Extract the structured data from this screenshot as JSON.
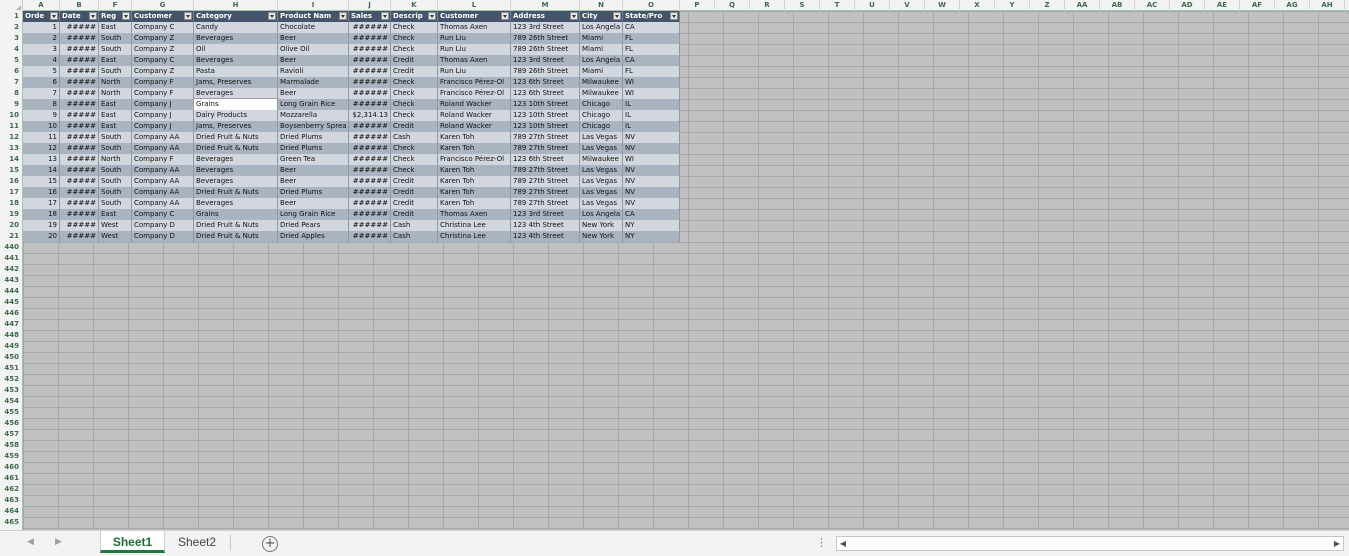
{
  "sheet": {
    "columns": [
      "A",
      "B",
      "F",
      "G",
      "H",
      "I",
      "J",
      "K",
      "L",
      "M",
      "N",
      "O",
      "P",
      "Q",
      "R",
      "S",
      "T",
      "U",
      "V",
      "W",
      "X",
      "Y",
      "Z",
      "AA",
      "AB",
      "AC",
      "AD",
      "AE",
      "AF",
      "AG",
      "AH"
    ],
    "row_numbers": [
      "1",
      "2",
      "3",
      "4",
      "5",
      "6",
      "7",
      "8",
      "9",
      "10",
      "11",
      "12",
      "13",
      "14",
      "15",
      "16",
      "17",
      "18",
      "19",
      "20",
      "21",
      "440",
      "441",
      "442",
      "443",
      "444",
      "445",
      "446",
      "447",
      "448",
      "449",
      "450",
      "451",
      "452",
      "453",
      "454",
      "455",
      "456",
      "457",
      "458",
      "459",
      "460",
      "461",
      "462",
      "463",
      "464",
      "465"
    ],
    "table_headers": [
      "Orde",
      "Date",
      "Reg",
      "Customer",
      "Category",
      "Product Nam",
      "Sales",
      "Descrip",
      "Customer",
      "Address",
      "City",
      "State/Pro"
    ],
    "rows": [
      [
        "1",
        "#####",
        "East",
        "Company C",
        "Candy",
        "Chocolate",
        "######",
        "Check",
        "Thomas Axen",
        "123 3rd Street",
        "Los Angela",
        "CA"
      ],
      [
        "2",
        "#####",
        "South",
        "Company Z",
        "Beverages",
        "Beer",
        "######",
        "Check",
        "Run Liu",
        "789 26th Street",
        "Miami",
        "FL"
      ],
      [
        "3",
        "#####",
        "South",
        "Company Z",
        "Oil",
        "Olive Oil",
        "######",
        "Check",
        "Run Liu",
        "789 26th Street",
        "Miami",
        "FL"
      ],
      [
        "4",
        "#####",
        "East",
        "Company C",
        "Beverages",
        "Beer",
        "######",
        "Credit",
        "Thomas Axen",
        "123 3rd Street",
        "Los Angela",
        "CA"
      ],
      [
        "5",
        "#####",
        "South",
        "Company Z",
        "Pasta",
        "Ravioli",
        "######",
        "Credit",
        "Run Liu",
        "789 26th Street",
        "Miami",
        "FL"
      ],
      [
        "6",
        "#####",
        "North",
        "Company F",
        "Jams, Preserves",
        "Marmalade",
        "######",
        "Check",
        "Francisco Pérez-Ol",
        "123 6th Street",
        "Milwaukee",
        "WI"
      ],
      [
        "7",
        "#####",
        "North",
        "Company F",
        "Beverages",
        "Beer",
        "######",
        "Check",
        "Francisco Pérez-Ol",
        "123 6th Street",
        "Milwaukee",
        "WI"
      ],
      [
        "8",
        "#####",
        "East",
        "Company J",
        "Grains",
        "Long Grain Rice",
        "######",
        "Check",
        "Roland Wacker",
        "123 10th Street",
        "Chicago",
        "IL"
      ],
      [
        "9",
        "#####",
        "East",
        "Company J",
        "Dairy Products",
        "Mozzarella",
        "$2,314.13",
        "Check",
        "Roland Wacker",
        "123 10th Street",
        "Chicago",
        "IL"
      ],
      [
        "10",
        "#####",
        "East",
        "Company J",
        "Jams, Preserves",
        "Boysenberry Sprea",
        "######",
        "Credit",
        "Roland Wacker",
        "123 10th Street",
        "Chicago",
        "IL"
      ],
      [
        "11",
        "#####",
        "South",
        "Company AA",
        "Dried Fruit & Nuts",
        "Dried Plums",
        "######",
        "Cash",
        "Karen Toh",
        "789 27th Street",
        "Las Vegas",
        "NV"
      ],
      [
        "12",
        "#####",
        "South",
        "Company AA",
        "Dried Fruit & Nuts",
        "Dried Plums",
        "######",
        "Check",
        "Karen Toh",
        "789 27th Street",
        "Las Vegas",
        "NV"
      ],
      [
        "13",
        "#####",
        "North",
        "Company F",
        "Beverages",
        "Green Tea",
        "######",
        "Check",
        "Francisco Pérez-Ol",
        "123 6th Street",
        "Milwaukee",
        "WI"
      ],
      [
        "14",
        "#####",
        "South",
        "Company AA",
        "Beverages",
        "Beer",
        "######",
        "Check",
        "Karen Toh",
        "789 27th Street",
        "Las Vegas",
        "NV"
      ],
      [
        "15",
        "#####",
        "South",
        "Company AA",
        "Beverages",
        "Beer",
        "######",
        "Credit",
        "Karen Toh",
        "789 27th Street",
        "Las Vegas",
        "NV"
      ],
      [
        "16",
        "#####",
        "South",
        "Company AA",
        "Dried Fruit & Nuts",
        "Dried Plums",
        "######",
        "Credit",
        "Karen Toh",
        "789 27th Street",
        "Las Vegas",
        "NV"
      ],
      [
        "17",
        "#####",
        "South",
        "Company AA",
        "Beverages",
        "Beer",
        "######",
        "Credit",
        "Karen Toh",
        "789 27th Street",
        "Las Vegas",
        "NV"
      ],
      [
        "18",
        "#####",
        "East",
        "Company C",
        "Grains",
        "Long Grain Rice",
        "######",
        "Credit",
        "Thomas Axen",
        "123 3rd Street",
        "Los Angela",
        "CA"
      ],
      [
        "19",
        "#####",
        "West",
        "Company D",
        "Dried Fruit & Nuts",
        "Dried Pears",
        "######",
        "Cash",
        "Christina Lee",
        "123 4th Street",
        "New York",
        "NY"
      ],
      [
        "20",
        "#####",
        "West",
        "Company D",
        "Dried Fruit & Nuts",
        "Dried Apples",
        "######",
        "Cash",
        "Christina Lee",
        "123 4th Street",
        "New York",
        "NY"
      ]
    ]
  },
  "tabs": [
    {
      "label": "Sheet1",
      "active": true
    },
    {
      "label": "Sheet2",
      "active": false
    }
  ],
  "icons": {
    "prev": "prev-sheet-icon",
    "next": "next-sheet-icon",
    "add": "add-sheet-icon",
    "scroll_left": "scroll-left-icon",
    "scroll_right": "scroll-right-icon"
  },
  "colors": {
    "header_fill": "#44546a",
    "band_light": "#d2d7df",
    "band_dark": "#aab3c0",
    "active_tab": "#1e7a3c"
  }
}
